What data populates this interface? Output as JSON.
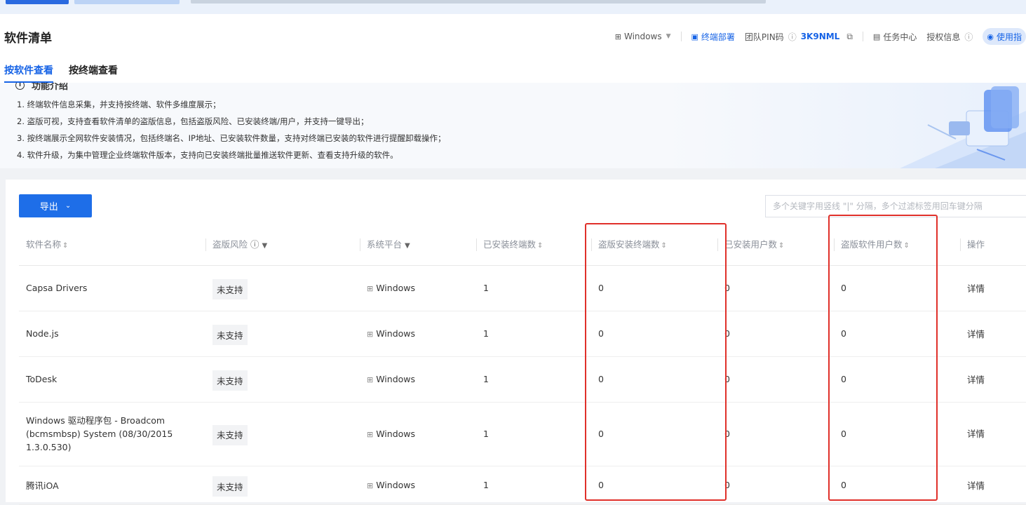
{
  "page": {
    "title": "软件清单",
    "tabs": [
      "按软件查看",
      "按终端查看"
    ]
  },
  "header": {
    "platform": "Windows",
    "deploy": "终端部署",
    "pin_label": "团队PIN码",
    "pin_value": "3K9NML",
    "task_center": "任务中心",
    "license_info": "授权信息",
    "usage": "使用指"
  },
  "intro": {
    "heading": "功能介绍",
    "items": [
      "1. 终端软件信息采集，并支持按终端、软件多维度展示；",
      "2. 盗版可视，支持查看软件清单的盗版信息，包括盗版风险、已安装终端/用户，并支持一键导出；",
      "3. 按终端展示全网软件安装情况，包括终端名、IP地址、已安装软件数量，支持对终端已安装的软件进行提醒卸载操作；",
      "4. 软件升级，为集中管理企业终端软件版本，支持向已安装终端批量推送软件更新、查看支持升级的软件。"
    ]
  },
  "toolbar": {
    "export_label": "导出",
    "search_placeholder": "多个关键字用竖线 \"|\" 分隔，多个过滤标签用回车键分隔"
  },
  "table": {
    "columns": [
      "软件名称",
      "盗版风险",
      "系统平台",
      "已安装终端数",
      "盗版安装终端数",
      "已安装用户数",
      "盗版软件用户数",
      "操作"
    ],
    "rows": [
      {
        "name": "Capsa Drivers",
        "risk": "未支持",
        "platform": "Windows",
        "installed_terminals": "1",
        "pirated_terminals": "0",
        "installed_users": "0",
        "pirated_users": "0",
        "action": "详情"
      },
      {
        "name": "Node.js",
        "risk": "未支持",
        "platform": "Windows",
        "installed_terminals": "1",
        "pirated_terminals": "0",
        "installed_users": "0",
        "pirated_users": "0",
        "action": "详情"
      },
      {
        "name": "ToDesk",
        "risk": "未支持",
        "platform": "Windows",
        "installed_terminals": "1",
        "pirated_terminals": "0",
        "installed_users": "0",
        "pirated_users": "0",
        "action": "详情"
      },
      {
        "name": "Windows 驱动程序包 - Broadcom (bcmsmbsp) System (08/30/2015 1.3.0.530)",
        "risk": "未支持",
        "platform": "Windows",
        "installed_terminals": "1",
        "pirated_terminals": "0",
        "installed_users": "0",
        "pirated_users": "0",
        "action": "详情"
      },
      {
        "name": "腾讯iOA",
        "risk": "未支持",
        "platform": "Windows",
        "installed_terminals": "1",
        "pirated_terminals": "0",
        "installed_users": "0",
        "pirated_users": "0",
        "action": "详情"
      }
    ]
  },
  "colors": {
    "accent": "#1663e6",
    "highlight": "#e0302a"
  }
}
